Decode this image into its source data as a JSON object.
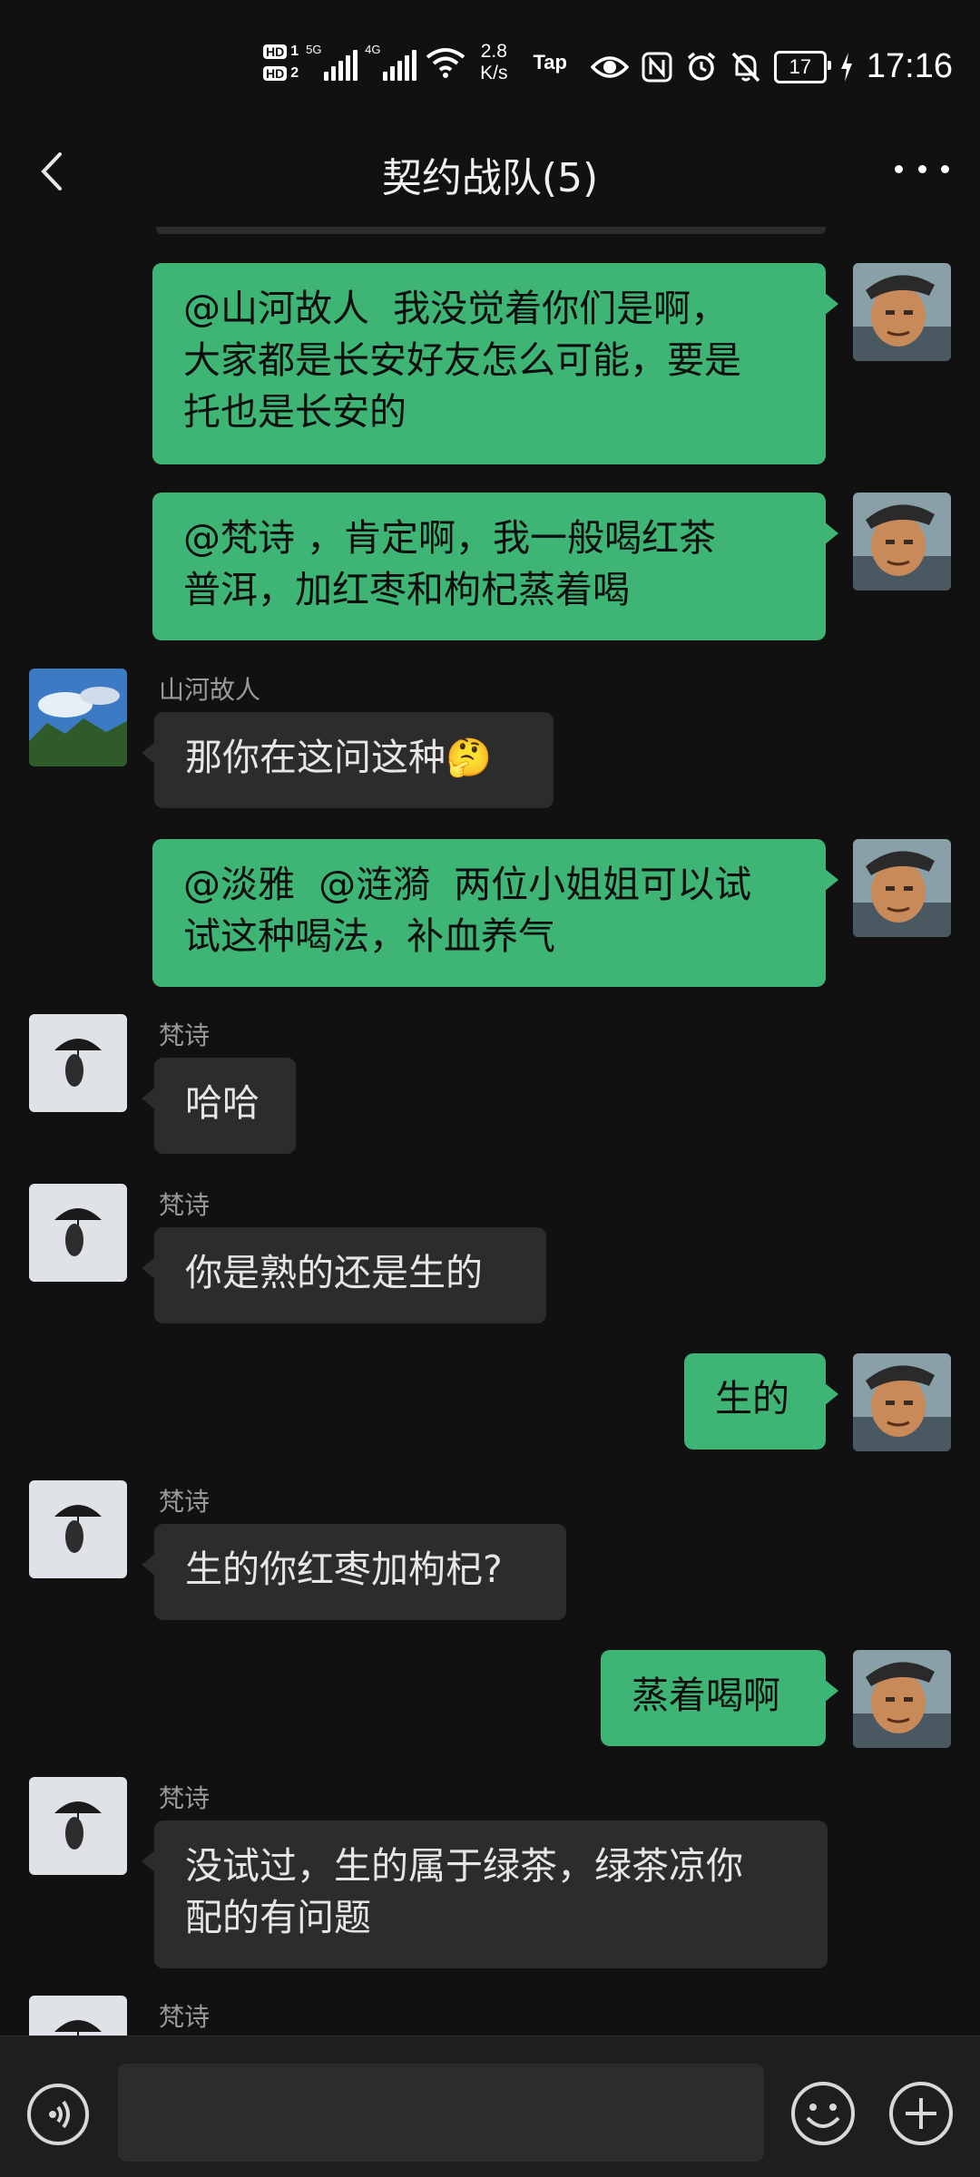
{
  "status_bar": {
    "sim1": "HD",
    "sim1_num": "1",
    "sim2": "HD",
    "sim2_num": "2",
    "net1": "5G",
    "net2": "4G",
    "speed_value": "2.8",
    "speed_unit": "K/s",
    "tap_label": "Tap",
    "battery": "17",
    "time": "17:16"
  },
  "header": {
    "title": "契约战队(5)"
  },
  "messages": [
    {
      "side": "out",
      "text": "@山河故人  我没觉着你们是啊，\n大家都是长安好友怎么可能，要是\n托也是长安的"
    },
    {
      "side": "out",
      "text": "@梵诗 ，肯定啊，我一般喝红茶\n普洱，加红枣和枸杞蒸着喝"
    },
    {
      "side": "in",
      "name": "山河故人",
      "text": "那你在这问这种🤔"
    },
    {
      "side": "out",
      "text": "@淡雅  @涟漪  两位小姐姐可以试\n试这种喝法，补血养气"
    },
    {
      "side": "in",
      "name": "梵诗",
      "text": "哈哈"
    },
    {
      "side": "in",
      "name": "梵诗",
      "text": "你是熟的还是生的"
    },
    {
      "side": "out",
      "text": "生的"
    },
    {
      "side": "in",
      "name": "梵诗",
      "text": "生的你红枣加枸杞?"
    },
    {
      "side": "out",
      "text": "蒸着喝啊"
    },
    {
      "side": "in",
      "name": "梵诗",
      "text": "没试过，生的属于绿茶，绿茶凉你\n配的有问题"
    },
    {
      "side": "in",
      "name": "梵诗",
      "text": ""
    }
  ],
  "input": {
    "value": "",
    "placeholder": ""
  },
  "colors": {
    "background": "#111111",
    "outgoing_bubble": "#3eb575",
    "incoming_bubble": "#2c2c2c"
  }
}
